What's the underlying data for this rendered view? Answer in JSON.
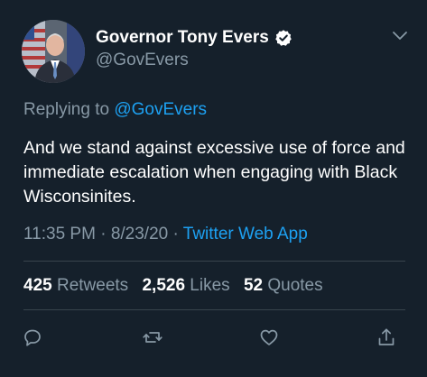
{
  "author": {
    "display_name": "Governor Tony Evers",
    "handle": "@GovEvers",
    "verified_icon": "verified-badge-icon"
  },
  "reply": {
    "prefix": "Replying to",
    "mention": "@GovEvers"
  },
  "tweet_text": "And we stand against excessive use of force and immediate escalation when engaging with Black Wisconsinites.",
  "meta": {
    "time": "11:35 PM",
    "separator1": " · ",
    "date": "8/23/20",
    "separator2": " · ",
    "source": "Twitter Web App"
  },
  "stats": {
    "retweets_count": "425",
    "retweets_label": "Retweets",
    "likes_count": "2,526",
    "likes_label": "Likes",
    "quotes_count": "52",
    "quotes_label": "Quotes"
  },
  "actions": [
    "reply-icon",
    "retweet-icon",
    "like-icon",
    "share-icon"
  ],
  "colors": {
    "background": "#15202b",
    "secondary_text": "#8899a6",
    "accent": "#1da1f2",
    "divider": "#38444d"
  }
}
